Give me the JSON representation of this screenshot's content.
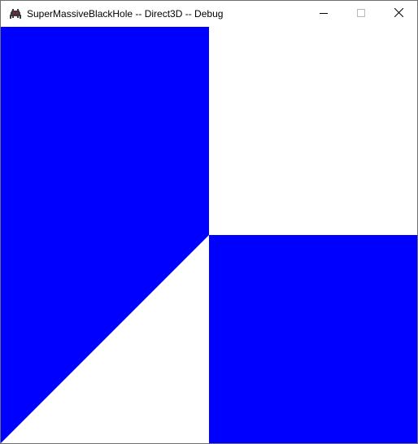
{
  "window": {
    "title": "SuperMassiveBlackHole -- Direct3D -- Debug"
  },
  "icons": {
    "app": "space-invader-icon",
    "minimize": "minimize-icon",
    "maximize": "maximize-icon",
    "close": "close-icon"
  },
  "colors": {
    "shape_fill": "#0000ff",
    "background": "#ffffff"
  }
}
